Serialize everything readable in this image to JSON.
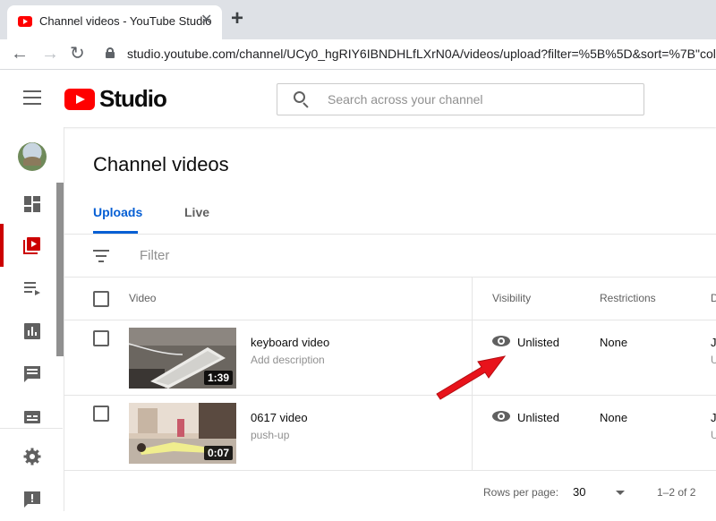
{
  "browser": {
    "tab_title": "Channel videos - YouTube Studio",
    "close_glyph": "✕",
    "new_tab_glyph": "+",
    "back_glyph": "←",
    "forward_glyph": "→",
    "reload_glyph": "↻",
    "url": "studio.youtube.com/channel/UCy0_hgRIY6IBNDHLfLXrN0A/videos/upload?filter=%5B%5D&sort=%7B\"colu"
  },
  "header": {
    "logo_text": "Studio",
    "search_placeholder": "Search across your channel"
  },
  "sidebar": {
    "items": [
      {
        "icon": "dashboard-icon",
        "active": false
      },
      {
        "icon": "videos-icon",
        "active": true
      },
      {
        "icon": "playlists-icon",
        "active": false
      },
      {
        "icon": "analytics-icon",
        "active": false
      },
      {
        "icon": "comments-icon",
        "active": false
      },
      {
        "icon": "subtitles-icon",
        "active": false
      },
      {
        "icon": "settings-icon",
        "active": false
      },
      {
        "icon": "feedback-icon",
        "active": false
      }
    ]
  },
  "main": {
    "title": "Channel videos",
    "tabs": [
      {
        "label": "Uploads",
        "active": true
      },
      {
        "label": "Live",
        "active": false
      }
    ],
    "filter_label": "Filter",
    "columns": {
      "video": "Video",
      "visibility": "Visibility",
      "restrictions": "Restrictions",
      "date_cut": "D"
    },
    "rows": [
      {
        "title": "keyboard video",
        "description": "Add description",
        "duration": "1:39",
        "visibility": "Unlisted",
        "restrictions": "None",
        "date_cut": "J",
        "date_sub_cut": "U"
      },
      {
        "title": "0617 video",
        "description": "push-up",
        "duration": "0:07",
        "visibility": "Unlisted",
        "restrictions": "None",
        "date_cut": "J",
        "date_sub_cut": "U"
      }
    ],
    "pagination": {
      "rows_per_page_label": "Rows per page:",
      "rows_per_page_value": "30",
      "range": "1–2 of 2"
    }
  },
  "colors": {
    "accent_blue": "#065fd4",
    "brand_red": "#ff0000",
    "active_red": "#cc0000",
    "annotation_arrow": "#e8131b"
  }
}
